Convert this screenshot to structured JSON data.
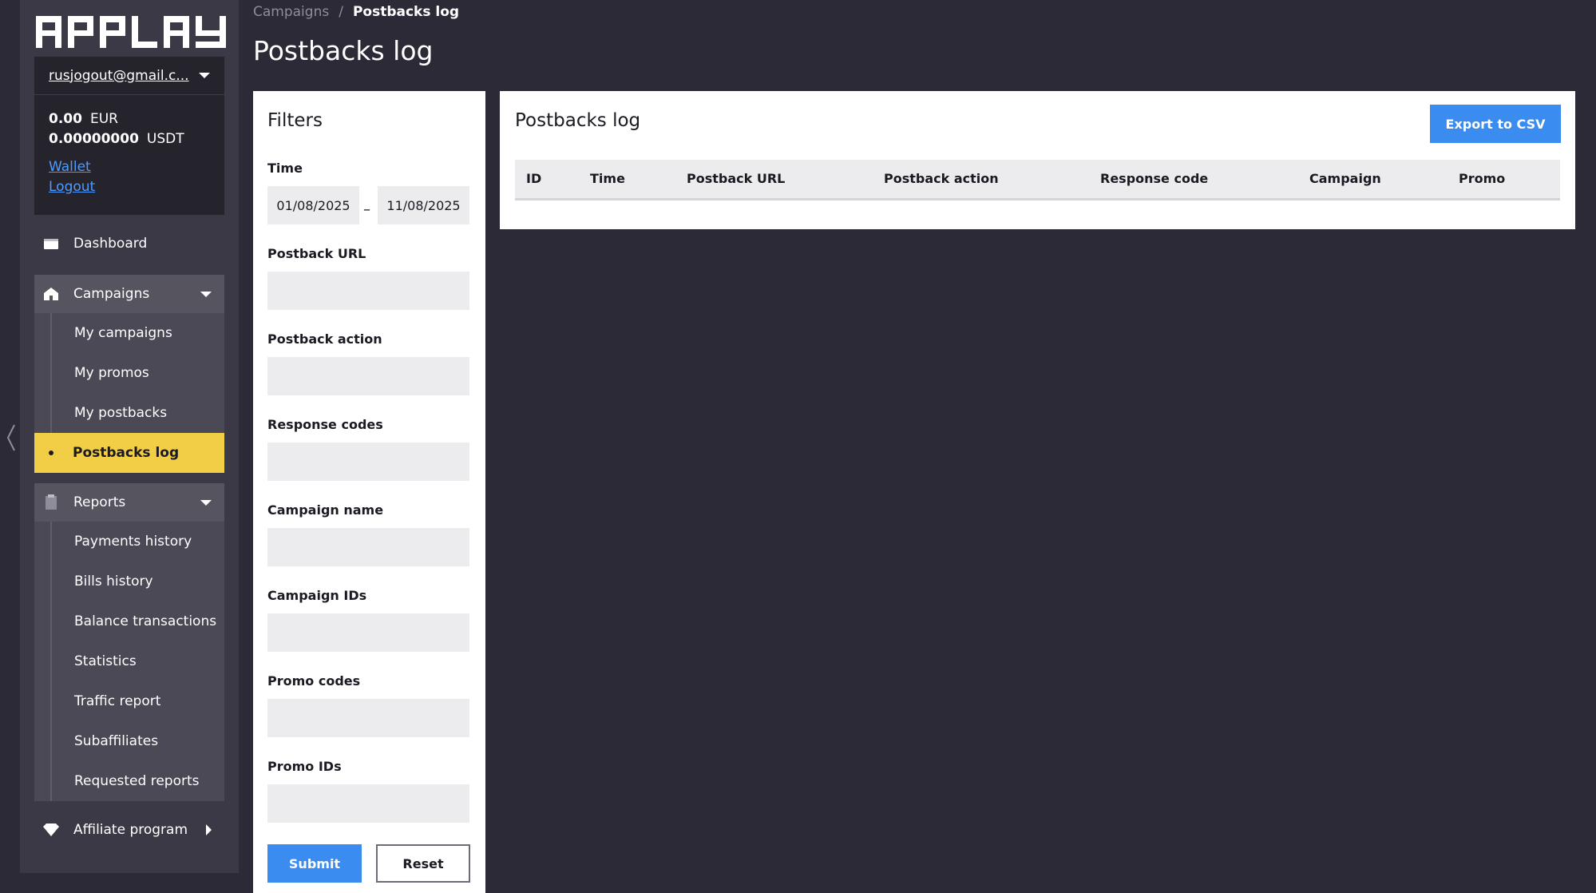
{
  "logo": {
    "text": "APPLAY"
  },
  "account": {
    "email": "rusjogout@gmail.c...",
    "balances": [
      {
        "amount": "0.00",
        "currency": "EUR"
      },
      {
        "amount": "0.00000000",
        "currency": "USDT"
      }
    ],
    "wallet_link": "Wallet",
    "logout_link": "Logout"
  },
  "nav": {
    "dashboard": "Dashboard",
    "campaigns": {
      "label": "Campaigns",
      "items": [
        "My campaigns",
        "My promos",
        "My postbacks",
        "Postbacks log"
      ]
    },
    "reports": {
      "label": "Reports",
      "items": [
        "Payments history",
        "Bills history",
        "Balance transactions",
        "Statistics",
        "Traffic report",
        "Subaffiliates",
        "Requested reports"
      ]
    },
    "affiliate": "Affiliate program"
  },
  "breadcrumb": {
    "parent": "Campaigns",
    "separator": "/",
    "current": "Postbacks log"
  },
  "page_title": "Postbacks log",
  "filters": {
    "title": "Filters",
    "time_label": "Time",
    "date_from": "01/08/2025",
    "date_sep": "–",
    "date_to": "11/08/2025",
    "fields": [
      {
        "label": "Postback URL",
        "value": ""
      },
      {
        "label": "Postback action",
        "value": ""
      },
      {
        "label": "Response codes",
        "value": ""
      },
      {
        "label": "Campaign name",
        "value": ""
      },
      {
        "label": "Campaign IDs",
        "value": ""
      },
      {
        "label": "Promo codes",
        "value": ""
      },
      {
        "label": "Promo IDs",
        "value": ""
      }
    ],
    "submit": "Submit",
    "reset": "Reset"
  },
  "log": {
    "title": "Postbacks log",
    "export": "Export to CSV",
    "columns": [
      "ID",
      "Time",
      "Postback URL",
      "Postback action",
      "Response code",
      "Campaign",
      "Promo"
    ]
  },
  "colors": {
    "background": "#2b2a36",
    "sidebar": "#3a3945",
    "active_item": "#f2ce46",
    "accent_blue": "#3b8cf1",
    "link": "#4d9bff"
  }
}
